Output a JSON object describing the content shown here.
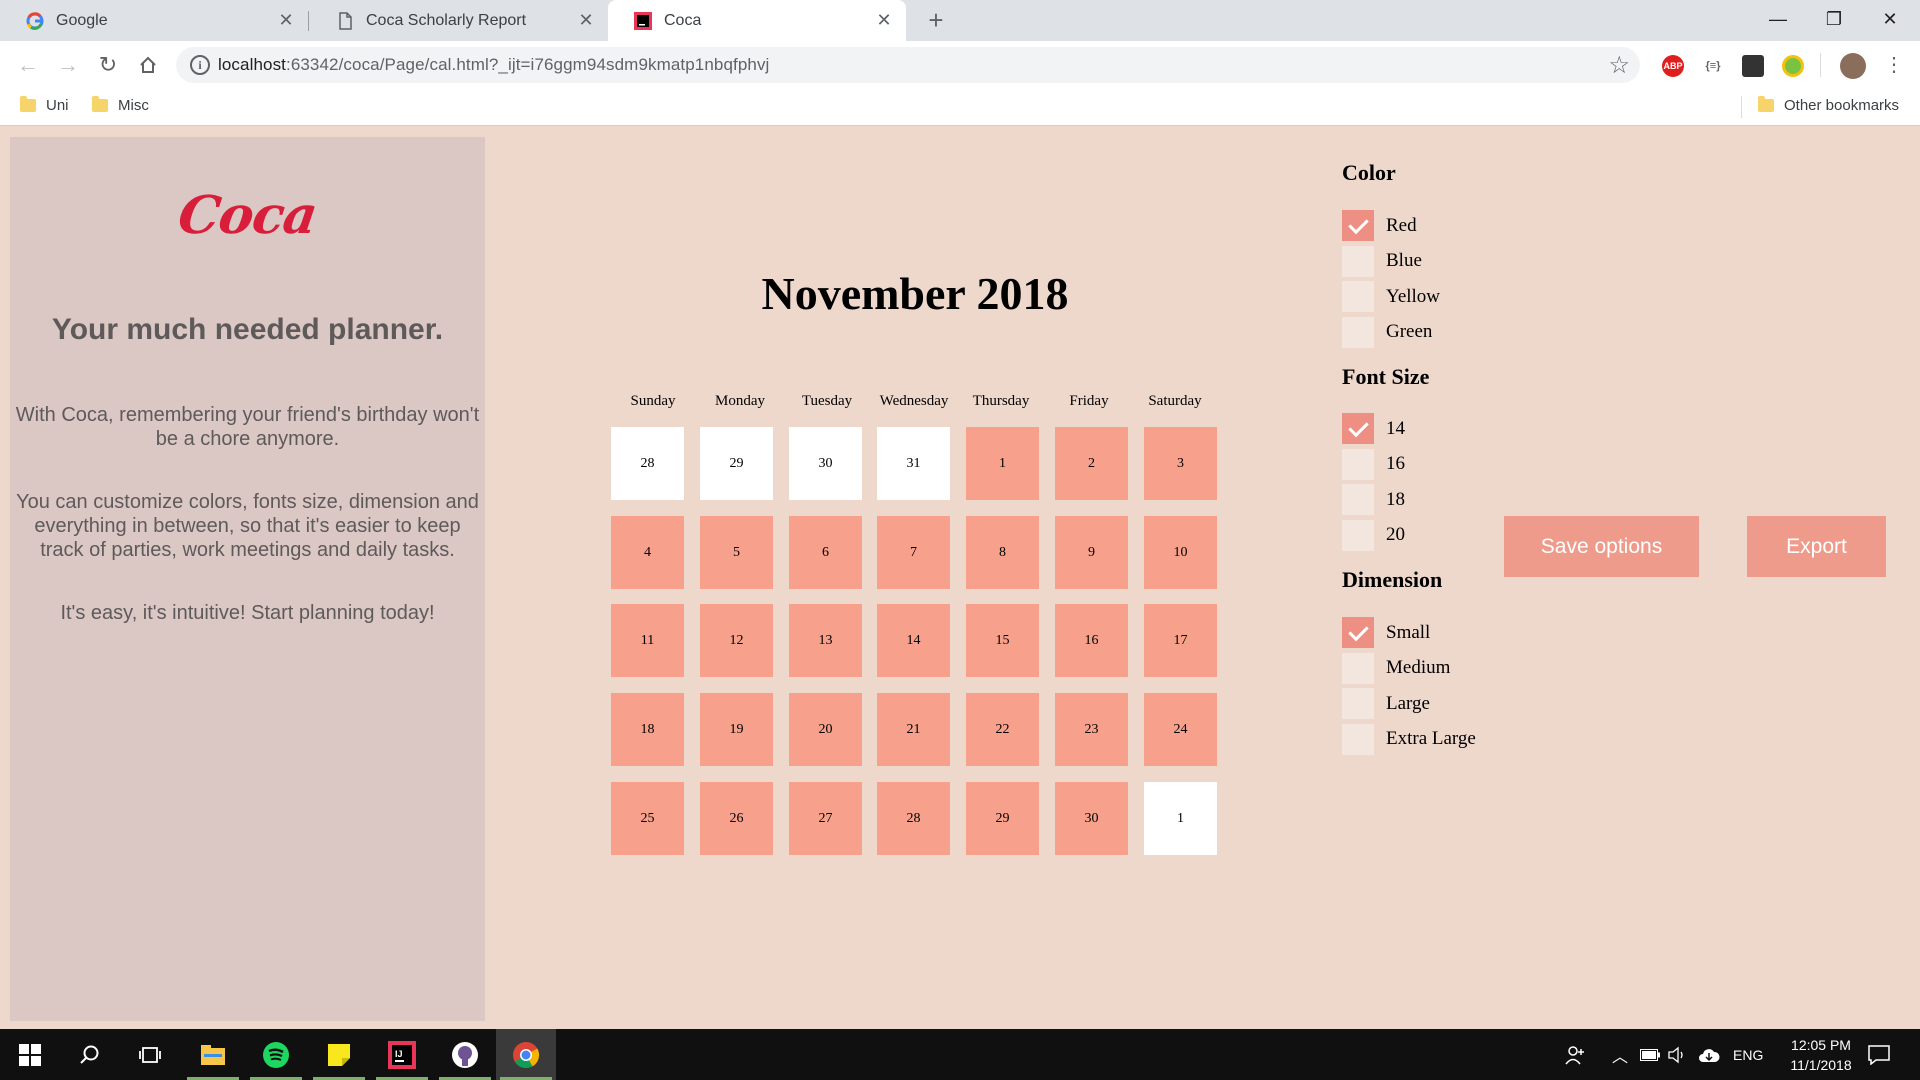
{
  "browser": {
    "tabs": [
      {
        "label": "Google",
        "icon": "google-icon"
      },
      {
        "label": "Coca Scholarly Report",
        "icon": "document-icon"
      },
      {
        "label": "Coca",
        "icon": "intellij-icon",
        "active": true
      }
    ],
    "url_host": "localhost",
    "url_rest": ":63342/coca/Page/cal.html?_ijt=i76ggm94sdm9kmatp1nbqfphvj",
    "bookmarks": [
      {
        "label": "Uni"
      },
      {
        "label": "Misc"
      }
    ],
    "other_bookmarks": "Other bookmarks",
    "extensions": {
      "abp": "ABP",
      "json": "{≡}"
    }
  },
  "sidebar": {
    "logo": "Coca",
    "tagline": "Your much needed planner.",
    "paragraphs": [
      "With Coca, remembering your friend's birthday won't be a chore anymore.",
      "You can customize colors, fonts size, dimension and everything in between, so that it's easier to keep track of parties, work meetings and daily tasks.",
      "It's easy, it's intuitive! Start planning today!"
    ]
  },
  "calendar": {
    "title": "November 2018",
    "weekdays": [
      "Sunday",
      "Monday",
      "Tuesday",
      "Wednesday",
      "Thursday",
      "Friday",
      "Saturday"
    ],
    "weeks": [
      [
        {
          "d": "28",
          "cur": false
        },
        {
          "d": "29",
          "cur": false
        },
        {
          "d": "30",
          "cur": false
        },
        {
          "d": "31",
          "cur": false
        },
        {
          "d": "1",
          "cur": true
        },
        {
          "d": "2",
          "cur": true
        },
        {
          "d": "3",
          "cur": true
        }
      ],
      [
        {
          "d": "4",
          "cur": true
        },
        {
          "d": "5",
          "cur": true
        },
        {
          "d": "6",
          "cur": true
        },
        {
          "d": "7",
          "cur": true
        },
        {
          "d": "8",
          "cur": true
        },
        {
          "d": "9",
          "cur": true
        },
        {
          "d": "10",
          "cur": true
        }
      ],
      [
        {
          "d": "11",
          "cur": true
        },
        {
          "d": "12",
          "cur": true
        },
        {
          "d": "13",
          "cur": true
        },
        {
          "d": "14",
          "cur": true
        },
        {
          "d": "15",
          "cur": true
        },
        {
          "d": "16",
          "cur": true
        },
        {
          "d": "17",
          "cur": true
        }
      ],
      [
        {
          "d": "18",
          "cur": true
        },
        {
          "d": "19",
          "cur": true
        },
        {
          "d": "20",
          "cur": true
        },
        {
          "d": "21",
          "cur": true
        },
        {
          "d": "22",
          "cur": true
        },
        {
          "d": "23",
          "cur": true
        },
        {
          "d": "24",
          "cur": true
        }
      ],
      [
        {
          "d": "25",
          "cur": true
        },
        {
          "d": "26",
          "cur": true
        },
        {
          "d": "27",
          "cur": true
        },
        {
          "d": "28",
          "cur": true
        },
        {
          "d": "29",
          "cur": true
        },
        {
          "d": "30",
          "cur": true
        },
        {
          "d": "1",
          "cur": false
        }
      ]
    ]
  },
  "options": {
    "groups": [
      {
        "title": "Color",
        "items": [
          {
            "label": "Red",
            "checked": true
          },
          {
            "label": "Blue",
            "checked": false
          },
          {
            "label": "Yellow",
            "checked": false
          },
          {
            "label": "Green",
            "checked": false
          }
        ]
      },
      {
        "title": "Font Size",
        "items": [
          {
            "label": "14",
            "checked": true
          },
          {
            "label": "16",
            "checked": false
          },
          {
            "label": "18",
            "checked": false
          },
          {
            "label": "20",
            "checked": false
          }
        ]
      },
      {
        "title": "Dimension",
        "items": [
          {
            "label": "Small",
            "checked": true
          },
          {
            "label": "Medium",
            "checked": false
          },
          {
            "label": "Large",
            "checked": false
          },
          {
            "label": "Extra Large",
            "checked": false
          }
        ]
      }
    ],
    "save_label": "Save options",
    "export_label": "Export"
  },
  "taskbar": {
    "language": "ENG",
    "time": "12:05 PM",
    "date": "11/1/2018"
  },
  "colors": {
    "page_bg": "#eed8cc",
    "sidebar_bg": "#dbc8c4",
    "logo": "#d81e3a",
    "day_current": "#f7a08b",
    "day_other": "#ffffff",
    "button": "#ee9b8c",
    "check_on": "#ee8f84"
  }
}
